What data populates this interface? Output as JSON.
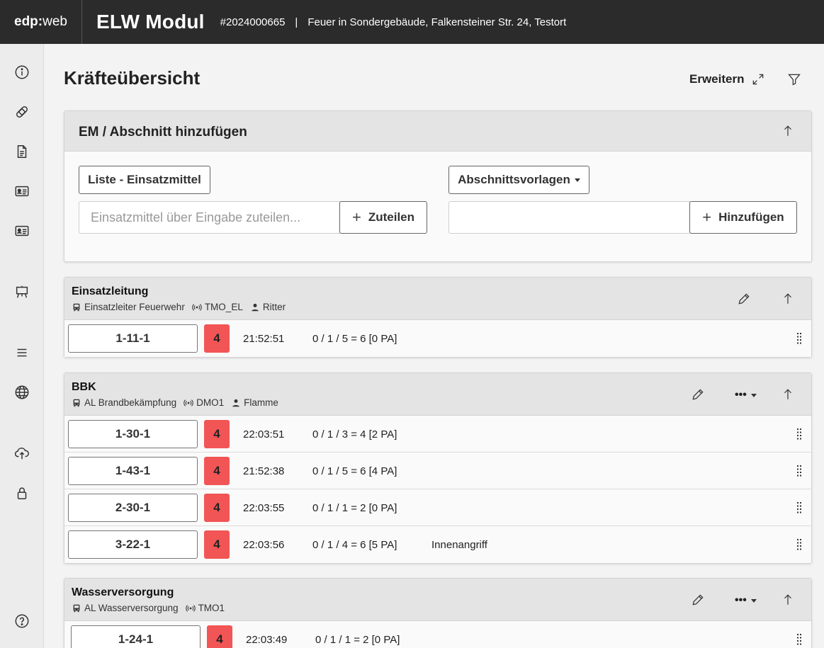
{
  "header": {
    "brand_bold": "edp:",
    "brand_light": "web",
    "module_title": "ELW Modul",
    "incident_number": "#2024000665",
    "separator": "|",
    "incident_text": "Feuer in Sondergebäude, Falkensteiner Str. 24, Testort"
  },
  "sidebar": {
    "items": [
      {
        "name": "info-icon"
      },
      {
        "name": "bandage-icon"
      },
      {
        "name": "document-icon"
      },
      {
        "name": "id-card-icon"
      },
      {
        "name": "id-card-icon-2"
      },
      {
        "name": "easel-icon"
      },
      {
        "name": "menu-icon"
      },
      {
        "name": "globe-icon"
      },
      {
        "name": "cloud-upload-icon"
      },
      {
        "name": "lock-icon"
      },
      {
        "name": "help-icon"
      }
    ]
  },
  "page": {
    "title": "Kräfteübersicht",
    "expand_label": "Erweitern"
  },
  "add_panel": {
    "title": "EM / Abschnitt hinzufügen",
    "list_button": "Liste - Einsatzmittel",
    "templates_button": "Abschnittsvorlagen",
    "unit_input_placeholder": "Einsatzmittel über Eingabe zuteilen...",
    "unit_input_value": "",
    "assign_button": "Zuteilen",
    "section_input_value": "",
    "add_button": "Hinzufügen",
    "plus_glyph": "+"
  },
  "sections": [
    {
      "title": "Einsatzleitung",
      "leader": "Einsatzleiter Feuerwehr",
      "radio": "TMO_EL",
      "person": "Ritter",
      "rows": [
        {
          "unit": "1-11-1",
          "status": "4",
          "time": "21:52:51",
          "strength": "0 / 1 / 5 = 6 [0 PA]",
          "task": ""
        }
      ]
    },
    {
      "title": "BBK",
      "leader": "AL Brandbekämpfung",
      "radio": "DMO1",
      "person": "Flamme",
      "more": "•••",
      "rows": [
        {
          "unit": "1-30-1",
          "status": "4",
          "time": "22:03:51",
          "strength": "0 / 1 / 3 = 4 [2 PA]",
          "task": ""
        },
        {
          "unit": "1-43-1",
          "status": "4",
          "time": "21:52:38",
          "strength": "0 / 1 / 5 = 6 [4 PA]",
          "task": ""
        },
        {
          "unit": "2-30-1",
          "status": "4",
          "time": "22:03:55",
          "strength": "0 / 1 / 1 = 2 [0 PA]",
          "task": ""
        },
        {
          "unit": "3-22-1",
          "status": "4",
          "time": "22:03:56",
          "strength": "0 / 1 / 4 = 6 [5 PA]",
          "task": "Innenangriff"
        }
      ]
    },
    {
      "title": "Wasserversorgung",
      "leader": "AL Wasserversorgung",
      "radio": "TMO1",
      "more": "•••",
      "rows": [
        {
          "unit": "1-24-1",
          "status": "4",
          "time": "22:03:49",
          "strength": "0 / 1 / 1 = 2 [0 PA]",
          "task": ""
        }
      ]
    }
  ],
  "colors": {
    "header_bg": "#2b2b2b",
    "status_red": "#f25555",
    "card_head_bg": "#e4e4e4"
  }
}
